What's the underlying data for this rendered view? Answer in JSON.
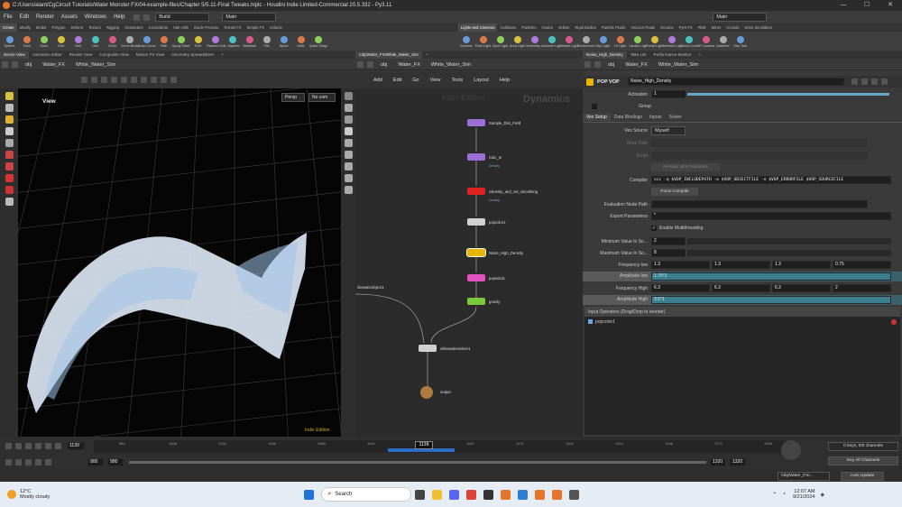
{
  "titlebar": {
    "title": "C:/Users/alant/CgCircuit Tutorials/Water Monster FX/04-example-files/Chapter 5/5.11-Final Tweaks.hiplc - Houdini Indie Limited-Commercial 20.5.332 - Py3.11"
  },
  "menubar": {
    "items": [
      "File",
      "Edit",
      "Render",
      "Assets",
      "Windows",
      "Help"
    ],
    "build": "Build",
    "main_desk": "Main",
    "right_desk": "Main"
  },
  "shelf_tabs_left": [
    "Create",
    "Modify",
    "Model",
    "Polygon",
    "Deform",
    "Texture",
    "Rigging",
    "Characters",
    "Constraints",
    "Hair Utils",
    "Guide Process",
    "Terrain FX",
    "Simple FX",
    "Volume"
  ],
  "shelf_tabs_right": [
    "Lights and Cameras",
    "Collisions",
    "Particles",
    "Grains",
    "Vellum",
    "Rigid Bodies",
    "Particle Fluids",
    "Viscous Fluids",
    "Oceans",
    "Pyro FX",
    "FEM",
    "Wires",
    "Crowds",
    "Drive Simulation"
  ],
  "tools_left": [
    "Sphere",
    "Tube",
    "Torus",
    "Grid",
    "Null",
    "Line",
    "Circle",
    "Curve Bezier",
    "Draw Curve",
    "Path",
    "Spray Paint",
    "Font",
    "Platonic Solids",
    "L-System",
    "Metaball",
    "File",
    "Spiral",
    "Helix",
    "Quick Shapes"
  ],
  "tools_right": [
    "Camera",
    "Point Light",
    "Spot Light",
    "Area Light",
    "Geometry Light",
    "Volume Light",
    "Distant Light",
    "Environment Light",
    "Sky Light",
    "GI Light",
    "Caustic Light",
    "Portal Light",
    "Ambient Light",
    "Stereo Camera",
    "VR Camera",
    "Switcher",
    "Gas Tool"
  ],
  "left_pane": {
    "tabs": [
      "Scene View",
      "Animation Editor",
      "Render View",
      "Composite View",
      "Motion FX View",
      "Geometry Spreadsheet"
    ],
    "path": [
      "obj",
      "Water_FX",
      "White_Water_Sim"
    ],
    "view_label": "View",
    "persp": "Persp",
    "cam": "No cam",
    "watermark": "Indie Edition"
  },
  "mid_pane": {
    "tabs": [
      "/obj/Water_FX/White_Water_Sim"
    ],
    "path": [
      "obj",
      "Water_FX",
      "White_Water_Sim"
    ],
    "menu": [
      "Add",
      "Edit",
      "Go",
      "View",
      "Tools",
      "Layout",
      "Help"
    ],
    "watermark": "Indie Edition",
    "context": "Dynamics",
    "nodes": [
      {
        "label": "Sample_Dist_Field",
        "color": "#9b6fd6"
      },
      {
        "label": "Calc_In",
        "sub": "Density",
        "color": "#9b6fd6"
      },
      {
        "label": "vdensity_and_vel_smoothing",
        "sub": "Density",
        "color": "#d22"
      },
      {
        "label": "popcolor1",
        "color": "#d0d0d0"
      },
      {
        "label": "Noise_High_Density",
        "color": "#e8b400"
      },
      {
        "label": "popwind1",
        "color": "#e052c0"
      },
      {
        "label": "gravity",
        "color": "#7bc83b"
      },
      {
        "label": "whitewatersolver1",
        "color": "#d0d0d0"
      },
      {
        "label": "output",
        "color": "#b07a40"
      }
    ],
    "input_label": "/dewaterobject1"
  },
  "right_pane": {
    "tabs": [
      "Noise_High_Density",
      "Take List",
      "Performance Monitor"
    ],
    "path": [
      "obj",
      "Water_FX",
      "White_Water_Sim"
    ],
    "node_type": "POP VOP",
    "node_name": "Noise_High_Density",
    "activation_label": "Activation",
    "activation_value": "1",
    "group_label": "Group",
    "subtabs": [
      "Vex Setup",
      "Data Bindings",
      "Inputs",
      "Solver"
    ],
    "vex_source_label": "Vex Source",
    "vex_source_value": "Myself",
    "shop_path_label": "Shop Path",
    "script_label": "Script",
    "reload_label": "Re-load VEX Functions",
    "compiler_label": "Compiler",
    "compiler_value": "vcc -q $VOP_INCLUDEPATH -o $VOP_OBJECTFILE -e $VOP_ERRORFILE $VOP_SOURCEFILE",
    "force_compile": "Force Compile",
    "eval_node_label": "Evaluation Node Path",
    "export_params_label": "Export Parameters",
    "export_params_value": "*",
    "multithread_label": "Enable Multithreading",
    "min_label": "Minimum Value In So...",
    "min_value": "2",
    "max_label": "Maximum Value In So...",
    "max_value": "8",
    "freq_low_label": "Frequency low",
    "freq_low": [
      "1.3",
      "1.3",
      "1.3",
      "0.75"
    ],
    "amp_low_label": "Amplitude low",
    "amp_low": "1.75*1",
    "freq_high_label": "Frequency High",
    "freq_high": [
      "6.3",
      "6.3",
      "6.3",
      "2"
    ],
    "amp_high_label": "Amplitude High",
    "amp_high": "3.5*1",
    "input_ops_label": "Input Operators (Drag/Drop to reorder)",
    "input_ops": [
      "popcolor1"
    ]
  },
  "timeline": {
    "frame": "1139",
    "current": "1139",
    "ticks": [
      "984",
      "1008",
      "1032",
      "1056",
      "1080",
      "1104",
      "1128",
      "1152",
      "1176",
      "1200",
      "1224",
      "1248",
      "1272",
      "1296"
    ],
    "range_start": "900",
    "range_start2": "900",
    "range_end": "1320",
    "range_end2": "1320",
    "keys": "0 keys, 0/0 channels",
    "key_all": "Key All Channels",
    "path": "/obj/Water_FX/...",
    "auto_update": "Auto Update"
  },
  "taskbar": {
    "temp": "12°C",
    "weather": "Mostly cloudy",
    "search": "Search",
    "time": "12:07 AM",
    "date": "9/21/2024"
  }
}
